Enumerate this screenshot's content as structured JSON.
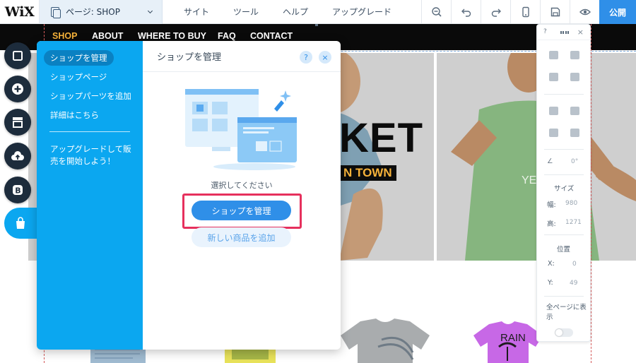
{
  "editor": {
    "logo": "WiX",
    "page_selector": "ページ: SHOP",
    "menu": [
      "サイト",
      "ツール",
      "ヘルプ",
      "アップグレード"
    ],
    "publish_label": "公開",
    "icons": [
      "zoom-icon",
      "undo-icon",
      "redo-icon",
      "mobile-icon",
      "save-icon",
      "preview-icon"
    ]
  },
  "site": {
    "nav": [
      "SHOP",
      "ABOUT",
      "WHERE TO BUY",
      "FAQ",
      "CONTACT"
    ],
    "active_nav": "SHOP",
    "hero_title": "KET",
    "hero_subtitle": "N TOWN",
    "product_texts": [
      "YES BA",
      "RAIN"
    ]
  },
  "rail": {
    "icons": [
      "page-icon",
      "add-icon",
      "store-icon",
      "upload-icon",
      "blog-icon",
      "shopping-bag-icon"
    ]
  },
  "store_panel": {
    "title": "ショップを管理",
    "help": "?",
    "close": "×",
    "side_items": [
      "ショップを管理",
      "ショップページ",
      "ショップパーツを追加",
      "詳細はこちら"
    ],
    "upgrade_text": "アップグレードして販売を開始しよう！",
    "prompt": "選択してください",
    "primary_button": "ショップを管理",
    "secondary_button": "新しい商品を追加"
  },
  "inspector": {
    "help": "?",
    "close": "×",
    "rotation": "0°",
    "size_label": "サイズ",
    "width_label": "幅:",
    "width_value": "980",
    "height_label": "高:",
    "height_value": "1271",
    "position_label": "位置",
    "x_label": "X:",
    "x_value": "0",
    "y_label": "Y:",
    "y_value": "49",
    "show_all_label": "全ページに表示",
    "show_all_on": false
  },
  "colors": {
    "accent": "#0ba7f0",
    "button": "#2f8fe8",
    "highlight": "#e6305d",
    "nav_active": "#f6b23a"
  }
}
